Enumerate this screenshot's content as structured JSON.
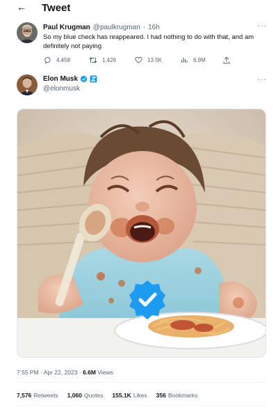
{
  "header": {
    "back_icon": "arrow-left-icon",
    "title": "Tweet"
  },
  "quoted_tweet": {
    "author_name": "Paul Krugman",
    "author_handle": "@paulkrugman",
    "time_sep": "·",
    "time": "16h",
    "more_label": "···",
    "text": "So my blue check has reappeared. I had nothing to do with that, and am definitely not paying",
    "replies": "4,458",
    "retweets": "1,426",
    "likes": "13.5K",
    "views": "6.9M"
  },
  "main_tweet": {
    "author_name": "Elon Musk",
    "author_handle": "@elonmusk",
    "more_label": "···",
    "media_description_icon": "verified-badge-icon",
    "time": "7:55 PM",
    "date_sep": "·",
    "date": "Apr 22, 2023",
    "views_sep": "·",
    "views_count": "6.6M",
    "views_label": "Views",
    "stats": {
      "retweets_count": "7,576",
      "retweets_label": "Retweets",
      "quotes_count": "1,060",
      "quotes_label": "Quotes",
      "likes_count": "155.1K",
      "likes_label": "Likes",
      "bookmarks_count": "356",
      "bookmarks_label": "Bookmarks"
    }
  },
  "colors": {
    "verified_blue": "#1d9bf0",
    "text_secondary": "#536471",
    "text_primary": "#0f1419"
  }
}
